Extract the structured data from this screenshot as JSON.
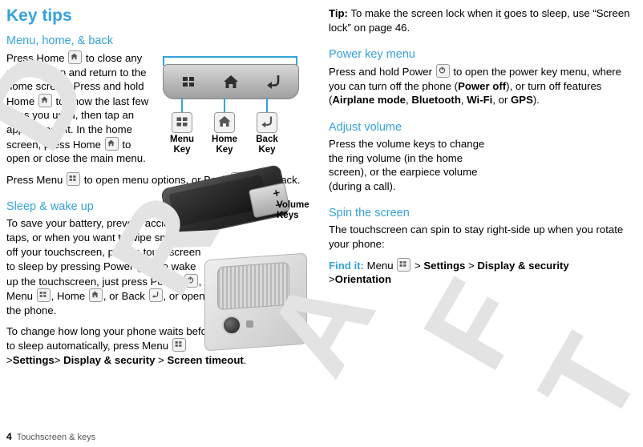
{
  "watermark": {
    "text": "DRAFT"
  },
  "left": {
    "title": "Key tips",
    "sections": [
      {
        "heading": "Menu, home, & back",
        "paragraphs": [
          "Press Home  to close any menu or app and return to the home screen. Press and hold Home  to show the last few apps you used, then tap an app to open it. In the home screen, press Home  to open or close the main menu.",
          "Press Menu  to open menu options, or Back  to go back."
        ]
      },
      {
        "heading": "Sleep & wake up",
        "paragraphs": [
          "To save your battery, prevent accidental taps, or when you want to wipe smudges off your touchscreen, put the touchscreen to sleep by pressing Power  . To wake up the touchscreen, just press Power  , Menu  , Home  , or Back  , or open the phone.",
          "To change how long your phone waits before the screen goes to sleep automatically, press Menu  > Settings > Display & security > Screen timeout."
        ]
      }
    ],
    "illustration": {
      "callouts": [
        {
          "line1": "Menu",
          "line2": "Key",
          "icon": "menu-key-icon"
        },
        {
          "line1": "Home",
          "line2": "Key",
          "icon": "home-key-icon"
        },
        {
          "line1": "Back",
          "line2": "Key",
          "icon": "back-key-icon"
        }
      ]
    },
    "para1_parts": {
      "a": "Press Home ",
      "b": " to close any menu or app and return to the home screen. Press and hold Home ",
      "c": " to show the last few apps you used, then tap an app to open it. In the home screen, press Home ",
      "d": " to open or close the main menu."
    },
    "para2_parts": {
      "a": "Press Menu ",
      "b": " to open menu options, or Back ",
      "c": " to go back."
    },
    "para3_parts": {
      "a": "To save your battery, prevent accidental taps, or when you want to wipe smudges off your touchscreen, put the touchscreen to sleep by pressing Power ",
      "b": ". To wake up the touchscreen, just press Power ",
      "c": ", Menu ",
      "d": ", Home ",
      "e": ", or Back ",
      "f": ", or open the phone."
    },
    "para4_parts": {
      "a": "To change how long your phone waits before the screen goes to sleep automatically, press Menu ",
      "b": ">",
      "c": "Settings",
      "d": ">",
      "e": "Display & security",
      "f": ">",
      "g": "Screen timeout",
      "h": "."
    }
  },
  "right": {
    "tip": {
      "label": "Tip:",
      "text": " To make the screen lock when it goes to sleep, use “Screen lock” on page 46."
    },
    "sections": [
      {
        "heading": "Power key menu",
        "parts": {
          "a": "Press and hold Power ",
          "b": " to open the power key menu, where you can turn off the phone (",
          "c": "Power off",
          "d": "), or turn off features (",
          "e": "Airplane mode",
          "f": ", ",
          "g": "Bluetooth",
          "h": ", ",
          "i": "Wi-Fi",
          "j": ", or ",
          "k": "GPS",
          "l": ")."
        }
      },
      {
        "heading": "Adjust volume",
        "text": "Press the volume keys to change the ring volume (in the home screen), or the earpiece volume (during a call)."
      },
      {
        "heading": "Spin the screen",
        "text": "The touchscreen can spin to stay right-side up when you rotate your phone:",
        "finditparts": {
          "label": "Find it:",
          "a": " Menu ",
          "b": ">",
          "c": "Settings",
          "d": ">",
          "e": "Display & security",
          "f": ">",
          "g": "Orientation"
        }
      }
    ],
    "volume_callout": {
      "line1": "Volume",
      "line2": "Keys"
    }
  },
  "footer": {
    "page": "4",
    "chapter": "Touchscreen & keys"
  }
}
